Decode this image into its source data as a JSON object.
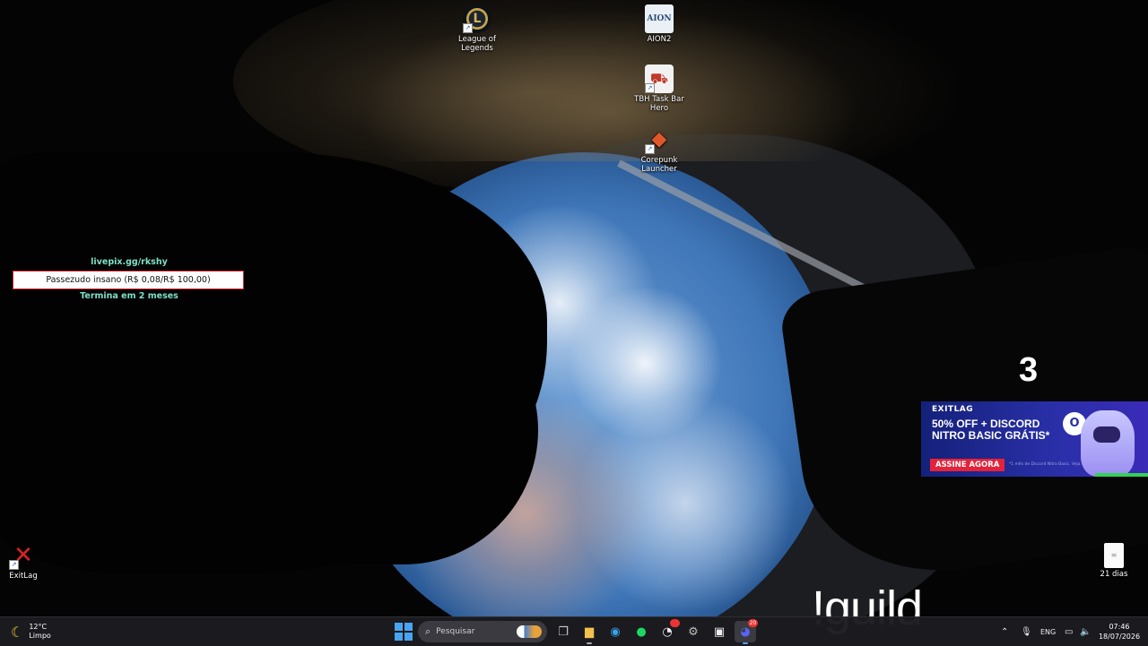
{
  "desktop": {
    "icons": [
      {
        "label": "League of Legends",
        "icon": "league-of-legends-icon"
      },
      {
        "label": "AION2",
        "icon": "aion2-icon",
        "glyph": "AION"
      },
      {
        "label": "TBH Task Bar Hero",
        "icon": "tbh-task-bar-hero-icon"
      },
      {
        "label": "Corepunk Launcher",
        "icon": "corepunk-launcher-icon"
      },
      {
        "label": "ExitLag",
        "icon": "exitlag-icon"
      },
      {
        "label": "21 dias",
        "icon": "text-document-icon"
      }
    ]
  },
  "livepix": {
    "link": "livepix.gg/rkshy",
    "goal": "Passezudo insano (R$ 0,08/R$ 100,00)",
    "progress_fraction": 0.0008,
    "ends": "Termina em 2 meses"
  },
  "overlay": {
    "counter": "3",
    "command": "!guild"
  },
  "ad": {
    "brand": "EXITLAG",
    "headline": "50% OFF + DISCORD NITRO BASIC GRÁTIS*",
    "cta": "ASSINE AGORA",
    "fine_print": "*1 mês de Discord Nitro Basic. Veja termos."
  },
  "taskbar": {
    "weather": {
      "temp": "12°C",
      "condition": "Limpo",
      "icon": "moon-icon"
    },
    "search_placeholder": "Pesquisar",
    "apps": [
      {
        "name": "task-view",
        "icon": "task-view-icon"
      },
      {
        "name": "file-explorer",
        "icon": "folder-icon"
      },
      {
        "name": "edge",
        "icon": "edge-icon"
      },
      {
        "name": "spotify",
        "icon": "spotify-icon"
      },
      {
        "name": "app-red",
        "icon": "app-icon"
      },
      {
        "name": "settings",
        "icon": "gear-icon"
      },
      {
        "name": "game-app",
        "icon": "game-icon"
      },
      {
        "name": "discord",
        "icon": "discord-icon",
        "badge": "20"
      }
    ],
    "language": "ENG",
    "time": "07:46",
    "date": "18/07/2026"
  },
  "colors": {
    "taskbar_bg": "#1c1c20",
    "livepix_text": "#7ee0c8",
    "livepix_border": "#d0212c",
    "ad_bg": "#2a2fa8",
    "ad_cta": "#e4233a"
  }
}
